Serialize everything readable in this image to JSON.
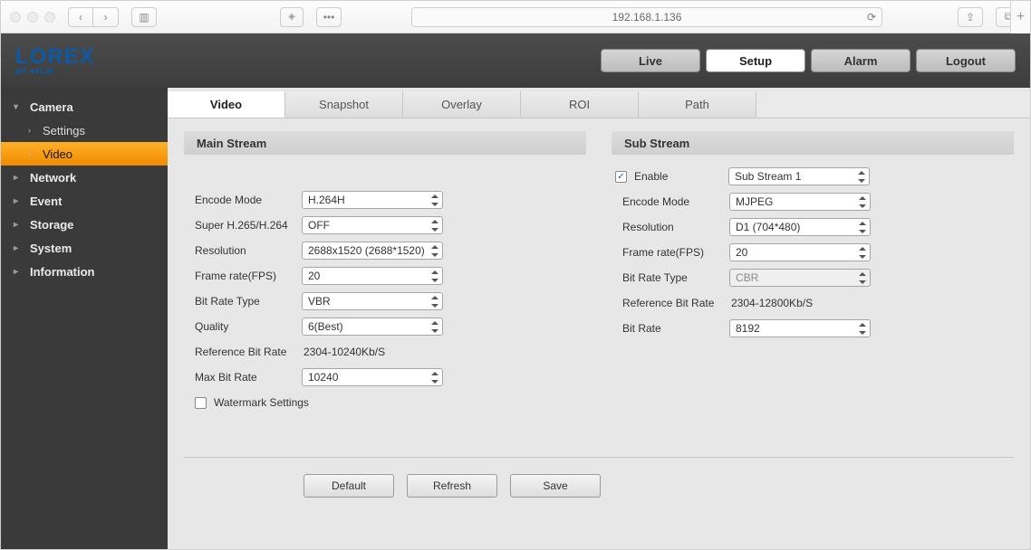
{
  "browser": {
    "url": "192.168.1.136"
  },
  "brand": {
    "name": "LOREX",
    "sub": "BY ✦FLIR"
  },
  "topnav": {
    "live": "Live",
    "setup": "Setup",
    "alarm": "Alarm",
    "logout": "Logout"
  },
  "sidebar": {
    "camera": {
      "label": "Camera",
      "settings": "Settings",
      "video": "Video"
    },
    "network": "Network",
    "event": "Event",
    "storage": "Storage",
    "system": "System",
    "information": "Information"
  },
  "tabs": {
    "video": "Video",
    "snapshot": "Snapshot",
    "overlay": "Overlay",
    "roi": "ROI",
    "path": "Path"
  },
  "main_stream": {
    "title": "Main Stream",
    "encode_mode_label": "Encode Mode",
    "encode_mode": "H.264H",
    "super_label": "Super H.265/H.264",
    "super": "OFF",
    "resolution_label": "Resolution",
    "resolution": "2688x1520 (2688*1520)",
    "fps_label": "Frame rate(FPS)",
    "fps": "20",
    "bitrate_type_label": "Bit Rate Type",
    "bitrate_type": "VBR",
    "quality_label": "Quality",
    "quality": "6(Best)",
    "ref_label": "Reference Bit Rate",
    "ref": "2304-10240Kb/S",
    "max_label": "Max Bit Rate",
    "max": "10240",
    "watermark_label": "Watermark Settings"
  },
  "sub_stream": {
    "title": "Sub Stream",
    "enable_label": "Enable",
    "enable_checked": true,
    "stream_sel": "Sub Stream 1",
    "encode_mode_label": "Encode Mode",
    "encode_mode": "MJPEG",
    "resolution_label": "Resolution",
    "resolution": "D1 (704*480)",
    "fps_label": "Frame rate(FPS)",
    "fps": "20",
    "bitrate_type_label": "Bit Rate Type",
    "bitrate_type": "CBR",
    "ref_label": "Reference Bit Rate",
    "ref": "2304-12800Kb/S",
    "bitrate_label": "Bit Rate",
    "bitrate": "8192"
  },
  "actions": {
    "default": "Default",
    "refresh": "Refresh",
    "save": "Save"
  }
}
